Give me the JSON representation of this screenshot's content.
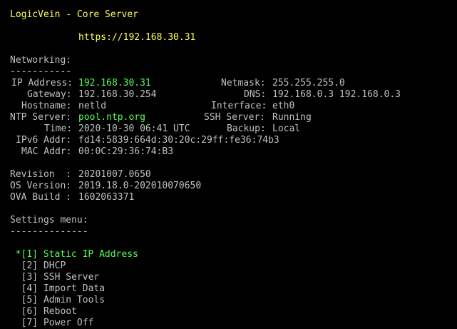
{
  "header": {
    "title": "LogicVein - Core Server",
    "url": "https://192.168.30.31"
  },
  "networking": {
    "heading": "Networking:",
    "underline": "-----------",
    "ip_label": "IP Address:",
    "ip_value": "192.168.30.31",
    "netmask_label": "Netmask:",
    "netmask_value": "255.255.255.0",
    "gateway_label": "Gateway:",
    "gateway_value": "192.168.30.254",
    "dns_label": "DNS:",
    "dns_value": "192.168.0.3 192.168.0.3",
    "hostname_label": "Hostname:",
    "hostname_value": "netld",
    "interface_label": "Interface:",
    "interface_value": "eth0",
    "ntp_label": "NTP Server:",
    "ntp_value": "pool.ntp.org",
    "ssh_label": "SSH Server:",
    "ssh_value": "Running",
    "time_label": "Time:",
    "time_value": "2020-10-30 06:41 UTC",
    "backup_label": "Backup:",
    "backup_value": "Local",
    "ipv6_label": "IPv6 Addr:",
    "ipv6_value": "fd14:5839:664d:30:20c:29ff:fe36:74b3",
    "mac_label": "MAC Addr:",
    "mac_value": "00:0C:29:36:74:B3"
  },
  "version": {
    "revision_label": "Revision  :",
    "revision_value": "20201007.0650",
    "os_label": "OS Version:",
    "os_value": "2019.18.0-202010070650",
    "ova_label": "OVA Build :",
    "ova_value": "1602063371"
  },
  "menu": {
    "heading": "Settings menu:",
    "underline": "--------------",
    "items": [
      {
        "prefix": "*[1]",
        "label": "Static IP Address"
      },
      {
        "prefix": "[2]",
        "label": "DHCP"
      },
      {
        "prefix": "[3]",
        "label": "SSH Server"
      },
      {
        "prefix": "[4]",
        "label": "Import Data"
      },
      {
        "prefix": "[5]",
        "label": "Admin Tools"
      },
      {
        "prefix": "[6]",
        "label": "Reboot"
      },
      {
        "prefix": "[7]",
        "label": "Power Off"
      }
    ]
  },
  "colors": {
    "background": "#000000",
    "text": "#c0c0c0",
    "title": "#ffff55",
    "highlight": "#55ff55"
  }
}
